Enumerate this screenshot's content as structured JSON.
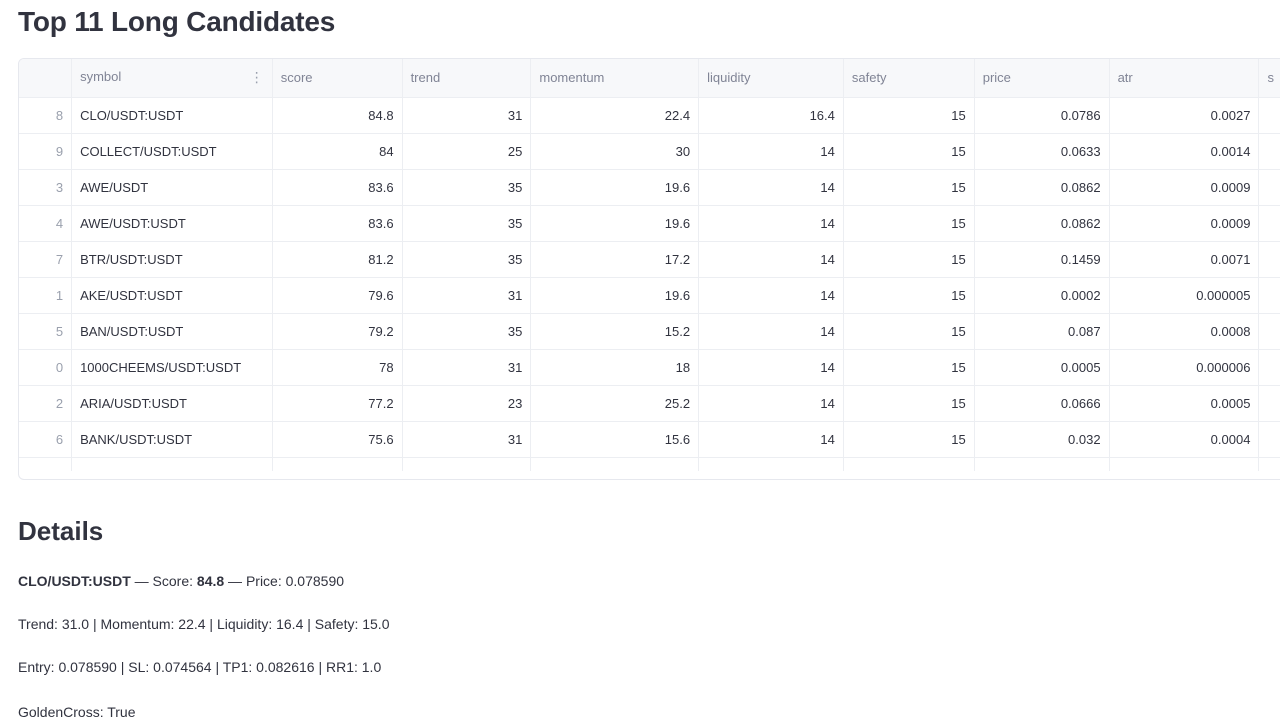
{
  "title": "Top 11 Long Candidates",
  "table": {
    "columns": [
      "",
      "symbol",
      "score",
      "trend",
      "momentum",
      "liquidity",
      "safety",
      "price",
      "atr",
      "s"
    ],
    "rows": [
      [
        "8",
        "CLO/USDT:USDT",
        "84.8",
        "31",
        "22.4",
        "16.4",
        "15",
        "0.0786",
        "0.0027",
        ""
      ],
      [
        "9",
        "COLLECT/USDT:USDT",
        "84",
        "25",
        "30",
        "14",
        "15",
        "0.0633",
        "0.0014",
        ""
      ],
      [
        "3",
        "AWE/USDT",
        "83.6",
        "35",
        "19.6",
        "14",
        "15",
        "0.0862",
        "0.0009",
        ""
      ],
      [
        "4",
        "AWE/USDT:USDT",
        "83.6",
        "35",
        "19.6",
        "14",
        "15",
        "0.0862",
        "0.0009",
        ""
      ],
      [
        "7",
        "BTR/USDT:USDT",
        "81.2",
        "35",
        "17.2",
        "14",
        "15",
        "0.1459",
        "0.0071",
        ""
      ],
      [
        "1",
        "AKE/USDT:USDT",
        "79.6",
        "31",
        "19.6",
        "14",
        "15",
        "0.0002",
        "0.000005",
        ""
      ],
      [
        "5",
        "BAN/USDT:USDT",
        "79.2",
        "35",
        "15.2",
        "14",
        "15",
        "0.087",
        "0.0008",
        ""
      ],
      [
        "0",
        "1000CHEEMS/USDT:USDT",
        "78",
        "31",
        "18",
        "14",
        "15",
        "0.0005",
        "0.000006",
        ""
      ],
      [
        "2",
        "ARIA/USDT:USDT",
        "77.2",
        "23",
        "25.2",
        "14",
        "15",
        "0.0666",
        "0.0005",
        ""
      ],
      [
        "6",
        "BANK/USDT:USDT",
        "75.6",
        "31",
        "15.6",
        "14",
        "15",
        "0.032",
        "0.0004",
        ""
      ]
    ]
  },
  "details": {
    "heading": "Details",
    "symbol": "CLO/USDT:USDT",
    "sep1": " — Score: ",
    "score": "84.8",
    "sep2": " — Price: 0.078590",
    "line2": "Trend: 31.0 | Momentum: 22.4 | Liquidity: 16.4 | Safety: 15.0",
    "line3": "Entry: 0.078590 | SL: 0.074564 | TP1: 0.082616 | RR1: 1.0",
    "line4": "GoldenCross: True"
  },
  "icons": {
    "column_menu": "more-vertical-icon"
  }
}
